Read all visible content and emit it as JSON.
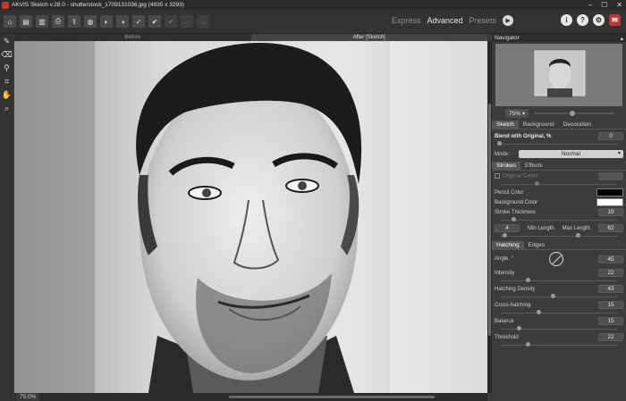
{
  "window": {
    "title": "AKVIS Sketch v.28.0 - shutterstock_1709131036.jpg (4935 x 3293)",
    "minimize": "–",
    "maximize": "☐",
    "close": "✕"
  },
  "modes": {
    "express": "Express",
    "advanced": "Advanced",
    "presets": "Presets"
  },
  "view_tabs": {
    "before": "Before",
    "after": "After [Sketch]"
  },
  "status": {
    "zoom": "75.0%"
  },
  "navigator": {
    "title": "Navigator",
    "zoom": "75%"
  },
  "settings_tabs": [
    "Sketch",
    "Background",
    "Decoration"
  ],
  "blend": {
    "label": "Blend with Original, %",
    "value": "0",
    "mode_label": "Mode:",
    "mode_value": "Normal"
  },
  "sub_tabs": [
    "Strokes",
    "Effects"
  ],
  "strokes": {
    "original_colors": "Original Colors",
    "pencil_color": "Pencil Color",
    "background_color": "Background Color",
    "stroke_thickness": "Stroke Thickness",
    "stroke_thickness_value": "19",
    "min_length_value": "4",
    "min_length": "Min Length",
    "max_length": "Max Length",
    "max_length_value": "62"
  },
  "hatch_tabs": [
    "Hatching",
    "Edges"
  ],
  "hatching": {
    "angle": "Angle, °",
    "angle_value": "45",
    "intensity": "Intensity",
    "intensity_value": "22",
    "density": "Hatching Density",
    "density_value": "43",
    "cross": "Cross-hatching",
    "cross_value": "15",
    "balance": "Balance",
    "balance_value": "15",
    "threshold": "Threshold",
    "threshold_value": "22"
  },
  "colors": {
    "pencil": "#000000",
    "background": "#ffffff",
    "accent_red": "#b93a3a"
  }
}
